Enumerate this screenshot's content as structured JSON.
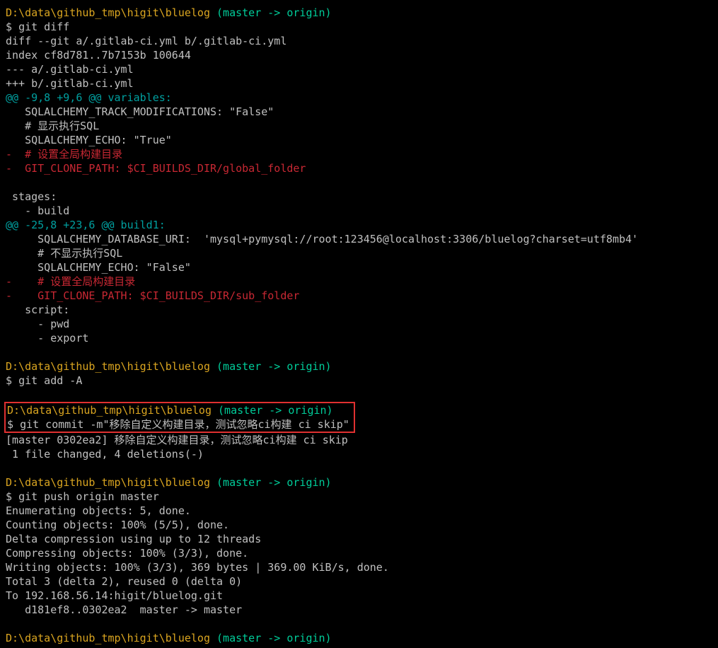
{
  "prompts": {
    "path": "D:\\data\\github_tmp\\higit\\bluelog",
    "branch": " (master -> origin)",
    "dollar": "$ "
  },
  "cmd": {
    "diff": "git diff",
    "add": "git add -A",
    "commit": "git commit -m\"移除自定义构建目录，测试忽略ci构建 ci skip\"",
    "push": "git push origin master"
  },
  "diff": {
    "header1": "diff --git a/.gitlab-ci.yml b/.gitlab-ci.yml",
    "header2": "index cf8d781..7b7153b 100644",
    "header3": "--- a/.gitlab-ci.yml",
    "header4": "+++ b/.gitlab-ci.yml",
    "hunk1": "@@ -9,8 +9,6 @@ variables:",
    "l1": "   SQLALCHEMY_TRACK_MODIFICATIONS: \"False\"",
    "l2": "   # 显示执行SQL",
    "l3": "   SQLALCHEMY_ECHO: \"True\"",
    "l4": "-  # 设置全局构建目录",
    "l5": "-  GIT_CLONE_PATH: $CI_BUILDS_DIR/global_folder",
    "l6": " stages:",
    "l7": "   - build",
    "hunk2": "@@ -25,8 +23,6 @@ build1:",
    "l8": "     SQLALCHEMY_DATABASE_URI:  'mysql+pymysql://root:123456@localhost:3306/bluelog?charset=utf8mb4'",
    "l9": "     # 不显示执行SQL",
    "l10": "     SQLALCHEMY_ECHO: \"False\"",
    "l11": "-    # 设置全局构建目录",
    "l12": "-    GIT_CLONE_PATH: $CI_BUILDS_DIR/sub_folder",
    "l13": "   script:",
    "l14": "     - pwd",
    "l15": "     - export"
  },
  "commit": {
    "r1": "[master 0302ea2] 移除自定义构建目录，测试忽略ci构建 ci skip",
    "r2": " 1 file changed, 4 deletions(-)"
  },
  "push": {
    "l1": "Enumerating objects: 5, done.",
    "l2": "Counting objects: 100% (5/5), done.",
    "l3": "Delta compression using up to 12 threads",
    "l4": "Compressing objects: 100% (3/3), done.",
    "l5": "Writing objects: 100% (3/3), 369 bytes | 369.00 KiB/s, done.",
    "l6": "Total 3 (delta 2), reused 0 (delta 0)",
    "l7": "To 192.168.56.14:higit/bluelog.git",
    "l8": "   d181ef8..0302ea2  master -> master"
  }
}
